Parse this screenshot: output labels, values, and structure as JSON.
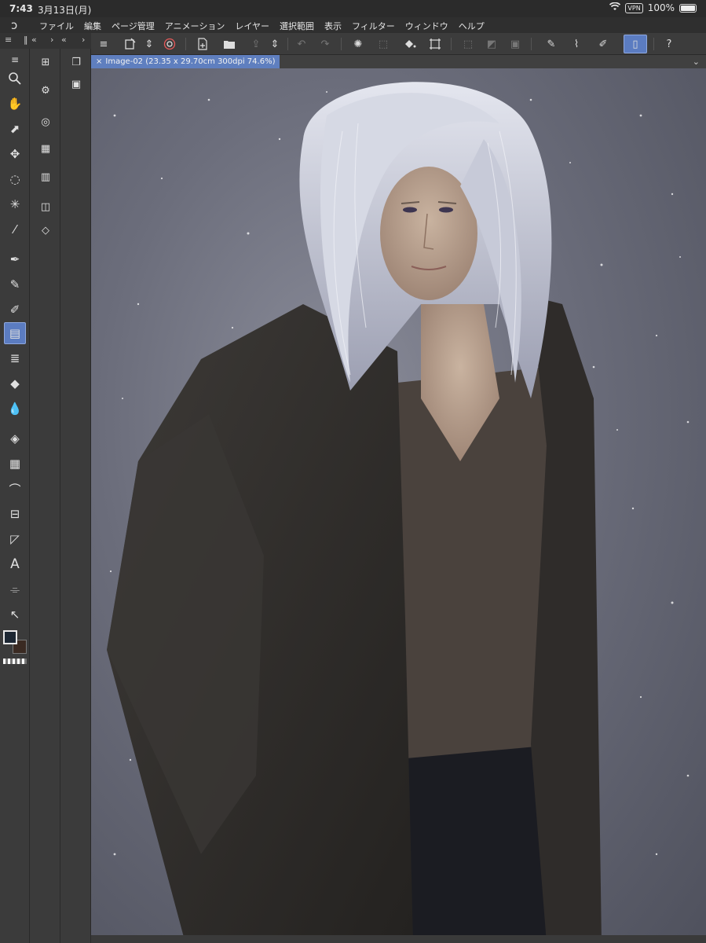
{
  "status": {
    "time": "7:43",
    "date": "3月13日(月)",
    "vpn": "VPN",
    "battery": "100%"
  },
  "menu": [
    "ファイル",
    "編集",
    "ページ管理",
    "アニメーション",
    "レイヤー",
    "選択範囲",
    "表示",
    "フィルター",
    "ウィンドウ",
    "ヘルプ"
  ],
  "tab": {
    "close": "×",
    "title": "Image-02 (23.35 x 29.70cm 300dpi 74.6%)"
  },
  "icons": {
    "app_logo": "clip-studio-logo",
    "tab_menu": "chevron-down-icon"
  },
  "colors": {
    "accent": "#5b7cc1",
    "main_color": "#1d2733",
    "sub_color": "#3a2a22"
  }
}
